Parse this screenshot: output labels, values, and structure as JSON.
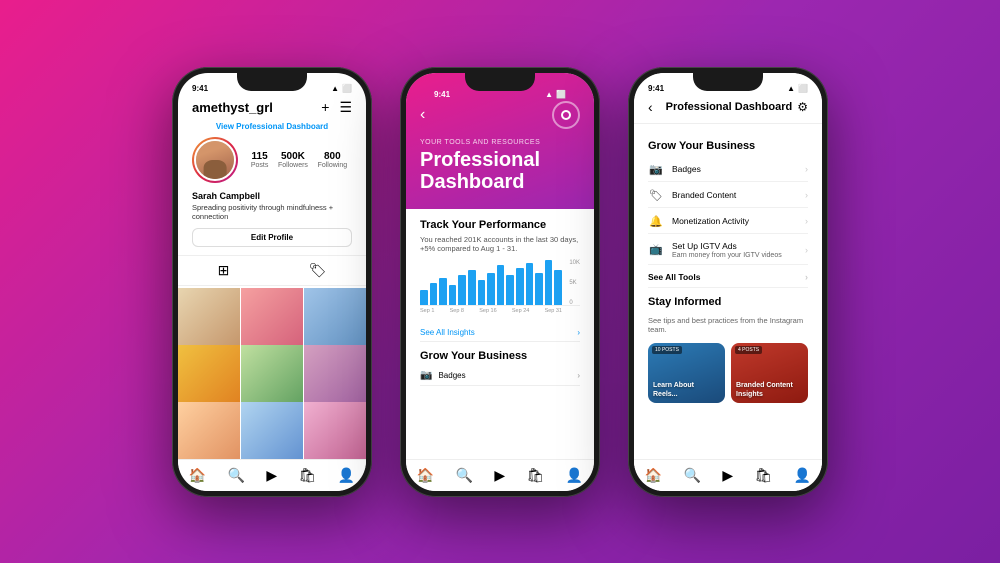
{
  "background": {
    "gradient": "linear-gradient(135deg, #e91e8c 0%, #9c27b0 50%, #7b1fa2 100%)"
  },
  "phone1": {
    "status": {
      "time": "9:41",
      "signal": "●●●",
      "wifi": "▲",
      "battery": "⬜"
    },
    "username": "amethyst_grl",
    "view_dashboard": "View Professional Dashboard",
    "stats": [
      {
        "num": "115",
        "label": "Posts"
      },
      {
        "num": "500K",
        "label": "Followers"
      },
      {
        "num": "800",
        "label": "Following"
      }
    ],
    "name": "Sarah Campbell",
    "bio": "Spreading positivity through mindfulness +\nconnection",
    "edit_btn": "Edit Profile",
    "bottom_nav": [
      "🏠",
      "🔍",
      "▶",
      "🛍",
      "👤"
    ]
  },
  "phone2": {
    "status": {
      "time": "9:41"
    },
    "tools_label": "YOUR TOOLS AND RESOURCES",
    "title_line1": "Professional",
    "title_line2": "Dashboard",
    "track_title": "Track Your Performance",
    "track_desc": "You reached 201K accounts in the last 30 days, +5% compared to Aug 1 - 31.",
    "chart": {
      "y_labels": [
        "10K",
        "5K",
        "0"
      ],
      "x_labels": [
        "Sep 1",
        "Sep 8",
        "Sep 16",
        "Sep 24",
        "Sep 31"
      ],
      "bars": [
        30,
        45,
        55,
        40,
        60,
        70,
        50,
        65,
        80,
        60,
        75,
        85,
        65,
        90,
        70
      ]
    },
    "see_insights": "See All Insights",
    "grow_title": "Grow Your Business",
    "grow_items": [
      {
        "icon": "📷",
        "label": "Badges"
      }
    ],
    "bottom_nav": [
      "🏠",
      "🔍",
      "▶",
      "🛍",
      "👤"
    ]
  },
  "phone3": {
    "status": {
      "time": "9:41"
    },
    "nav_title": "Professional Dashboard",
    "grow_title": "Grow Your Business",
    "items": [
      {
        "icon": "📷",
        "label": "Badges",
        "sub": ""
      },
      {
        "icon": "🏷",
        "label": "Branded Content",
        "sub": ""
      },
      {
        "icon": "🔔",
        "label": "Monetization Activity",
        "sub": ""
      },
      {
        "icon": "📺",
        "label": "Set Up IGTV Ads",
        "sub": "Earn money from your IGTV videos"
      }
    ],
    "see_all_tools": "See All Tools",
    "stay_title": "Stay Informed",
    "stay_desc": "See tips and best practices from the Instagram team.",
    "cards": [
      {
        "badge": "10 POSTS",
        "title": "Learn About Reels...",
        "bg1": "#2c7bb6",
        "bg2": "#1a4a7a"
      },
      {
        "badge": "4 POSTS",
        "title": "Branded Content Insights",
        "bg1": "#c0392b",
        "bg2": "#8e1a10"
      }
    ],
    "bottom_nav": [
      "🏠",
      "🔍",
      "▶",
      "🛍",
      "👤"
    ]
  }
}
